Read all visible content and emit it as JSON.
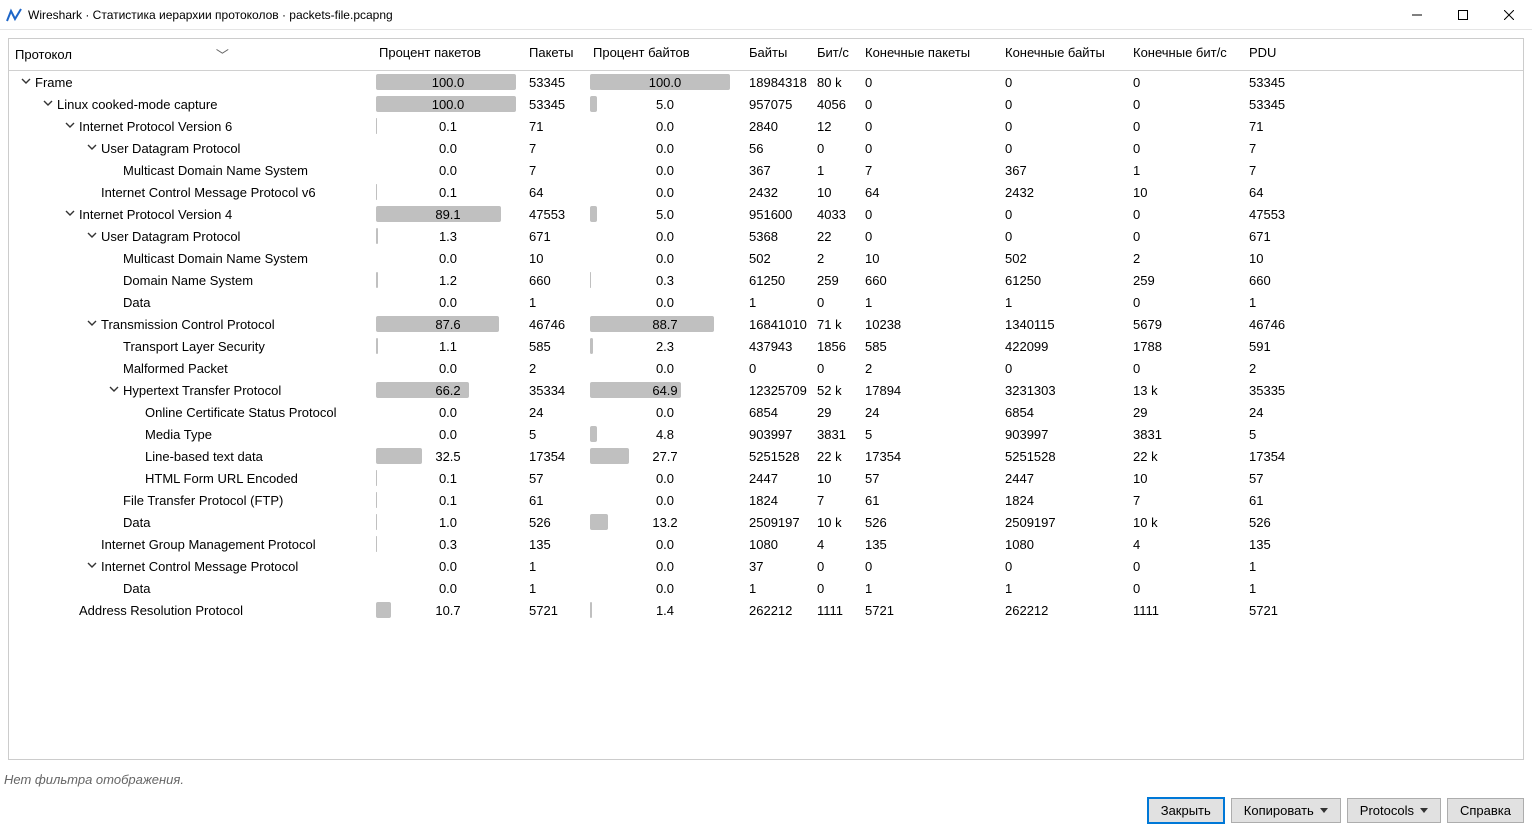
{
  "titlebar": {
    "title": "Wireshark · Статистика иерархии протоколов · packets-file.pcapng"
  },
  "columns": [
    "Протокол",
    "Процент пакетов",
    "Пакеты",
    "Процент байтов",
    "Байты",
    "Бит/с",
    "Конечные пакеты",
    "Конечные байты",
    "Конечные бит/с",
    "PDU"
  ],
  "rows": [
    {
      "depth": 0,
      "exp": "open",
      "name": "Frame",
      "ppct": "100.0",
      "pkts": "53345",
      "bpct": "100.0",
      "bytes": "18984318",
      "bits": "80 k",
      "ep": "0",
      "eb": "0",
      "ebits": "0",
      "pdu": "53345",
      "pbar": 100,
      "bbar": 100
    },
    {
      "depth": 1,
      "exp": "open",
      "name": "Linux cooked-mode capture",
      "ppct": "100.0",
      "pkts": "53345",
      "bpct": "5.0",
      "bytes": "957075",
      "bits": "4056",
      "ep": "0",
      "eb": "0",
      "ebits": "0",
      "pdu": "53345",
      "pbar": 100,
      "bbar": 5
    },
    {
      "depth": 2,
      "exp": "open",
      "name": "Internet Protocol Version 6",
      "ppct": "0.1",
      "pkts": "71",
      "bpct": "0.0",
      "bytes": "2840",
      "bits": "12",
      "ep": "0",
      "eb": "0",
      "ebits": "0",
      "pdu": "71",
      "pbar": 0.1,
      "bbar": 0
    },
    {
      "depth": 3,
      "exp": "open",
      "name": "User Datagram Protocol",
      "ppct": "0.0",
      "pkts": "7",
      "bpct": "0.0",
      "bytes": "56",
      "bits": "0",
      "ep": "0",
      "eb": "0",
      "ebits": "0",
      "pdu": "7",
      "pbar": 0,
      "bbar": 0
    },
    {
      "depth": 4,
      "exp": "none",
      "name": "Multicast Domain Name System",
      "ppct": "0.0",
      "pkts": "7",
      "bpct": "0.0",
      "bytes": "367",
      "bits": "1",
      "ep": "7",
      "eb": "367",
      "ebits": "1",
      "pdu": "7",
      "pbar": 0,
      "bbar": 0
    },
    {
      "depth": 3,
      "exp": "none",
      "name": "Internet Control Message Protocol v6",
      "ppct": "0.1",
      "pkts": "64",
      "bpct": "0.0",
      "bytes": "2432",
      "bits": "10",
      "ep": "64",
      "eb": "2432",
      "ebits": "10",
      "pdu": "64",
      "pbar": 0.1,
      "bbar": 0
    },
    {
      "depth": 2,
      "exp": "open",
      "name": "Internet Protocol Version 4",
      "ppct": "89.1",
      "pkts": "47553",
      "bpct": "5.0",
      "bytes": "951600",
      "bits": "4033",
      "ep": "0",
      "eb": "0",
      "ebits": "0",
      "pdu": "47553",
      "pbar": 89.1,
      "bbar": 5
    },
    {
      "depth": 3,
      "exp": "open",
      "name": "User Datagram Protocol",
      "ppct": "1.3",
      "pkts": "671",
      "bpct": "0.0",
      "bytes": "5368",
      "bits": "22",
      "ep": "0",
      "eb": "0",
      "ebits": "0",
      "pdu": "671",
      "pbar": 1.3,
      "bbar": 0
    },
    {
      "depth": 4,
      "exp": "none",
      "name": "Multicast Domain Name System",
      "ppct": "0.0",
      "pkts": "10",
      "bpct": "0.0",
      "bytes": "502",
      "bits": "2",
      "ep": "10",
      "eb": "502",
      "ebits": "2",
      "pdu": "10",
      "pbar": 0,
      "bbar": 0
    },
    {
      "depth": 4,
      "exp": "none",
      "name": "Domain Name System",
      "ppct": "1.2",
      "pkts": "660",
      "bpct": "0.3",
      "bytes": "61250",
      "bits": "259",
      "ep": "660",
      "eb": "61250",
      "ebits": "259",
      "pdu": "660",
      "pbar": 1.2,
      "bbar": 0.3
    },
    {
      "depth": 4,
      "exp": "none",
      "name": "Data",
      "ppct": "0.0",
      "pkts": "1",
      "bpct": "0.0",
      "bytes": "1",
      "bits": "0",
      "ep": "1",
      "eb": "1",
      "ebits": "0",
      "pdu": "1",
      "pbar": 0,
      "bbar": 0
    },
    {
      "depth": 3,
      "exp": "open",
      "name": "Transmission Control Protocol",
      "ppct": "87.6",
      "pkts": "46746",
      "bpct": "88.7",
      "bytes": "16841010",
      "bits": "71 k",
      "ep": "10238",
      "eb": "1340115",
      "ebits": "5679",
      "pdu": "46746",
      "pbar": 87.6,
      "bbar": 88.7
    },
    {
      "depth": 4,
      "exp": "none",
      "name": "Transport Layer Security",
      "ppct": "1.1",
      "pkts": "585",
      "bpct": "2.3",
      "bytes": "437943",
      "bits": "1856",
      "ep": "585",
      "eb": "422099",
      "ebits": "1788",
      "pdu": "591",
      "pbar": 1.1,
      "bbar": 2.3
    },
    {
      "depth": 4,
      "exp": "none",
      "name": "Malformed Packet",
      "ppct": "0.0",
      "pkts": "2",
      "bpct": "0.0",
      "bytes": "0",
      "bits": "0",
      "ep": "2",
      "eb": "0",
      "ebits": "0",
      "pdu": "2",
      "pbar": 0,
      "bbar": 0
    },
    {
      "depth": 4,
      "exp": "open",
      "name": "Hypertext Transfer Protocol",
      "ppct": "66.2",
      "pkts": "35334",
      "bpct": "64.9",
      "bytes": "12325709",
      "bits": "52 k",
      "ep": "17894",
      "eb": "3231303",
      "ebits": "13 k",
      "pdu": "35335",
      "pbar": 66.2,
      "bbar": 64.9
    },
    {
      "depth": 5,
      "exp": "none",
      "name": "Online Certificate Status Protocol",
      "ppct": "0.0",
      "pkts": "24",
      "bpct": "0.0",
      "bytes": "6854",
      "bits": "29",
      "ep": "24",
      "eb": "6854",
      "ebits": "29",
      "pdu": "24",
      "pbar": 0,
      "bbar": 0
    },
    {
      "depth": 5,
      "exp": "none",
      "name": "Media Type",
      "ppct": "0.0",
      "pkts": "5",
      "bpct": "4.8",
      "bytes": "903997",
      "bits": "3831",
      "ep": "5",
      "eb": "903997",
      "ebits": "3831",
      "pdu": "5",
      "pbar": 0,
      "bbar": 4.8
    },
    {
      "depth": 5,
      "exp": "none",
      "name": "Line-based text data",
      "ppct": "32.5",
      "pkts": "17354",
      "bpct": "27.7",
      "bytes": "5251528",
      "bits": "22 k",
      "ep": "17354",
      "eb": "5251528",
      "ebits": "22 k",
      "pdu": "17354",
      "pbar": 32.5,
      "bbar": 27.7
    },
    {
      "depth": 5,
      "exp": "none",
      "name": "HTML Form URL Encoded",
      "ppct": "0.1",
      "pkts": "57",
      "bpct": "0.0",
      "bytes": "2447",
      "bits": "10",
      "ep": "57",
      "eb": "2447",
      "ebits": "10",
      "pdu": "57",
      "pbar": 0.1,
      "bbar": 0
    },
    {
      "depth": 4,
      "exp": "none",
      "name": "File Transfer Protocol (FTP)",
      "ppct": "0.1",
      "pkts": "61",
      "bpct": "0.0",
      "bytes": "1824",
      "bits": "7",
      "ep": "61",
      "eb": "1824",
      "ebits": "7",
      "pdu": "61",
      "pbar": 0.1,
      "bbar": 0
    },
    {
      "depth": 4,
      "exp": "none",
      "name": "Data",
      "ppct": "1.0",
      "pkts": "526",
      "bpct": "13.2",
      "bytes": "2509197",
      "bits": "10 k",
      "ep": "526",
      "eb": "2509197",
      "ebits": "10 k",
      "pdu": "526",
      "pbar": 1,
      "bbar": 13.2
    },
    {
      "depth": 3,
      "exp": "none",
      "name": "Internet Group Management Protocol",
      "ppct": "0.3",
      "pkts": "135",
      "bpct": "0.0",
      "bytes": "1080",
      "bits": "4",
      "ep": "135",
      "eb": "1080",
      "ebits": "4",
      "pdu": "135",
      "pbar": 0.3,
      "bbar": 0
    },
    {
      "depth": 3,
      "exp": "open",
      "name": "Internet Control Message Protocol",
      "ppct": "0.0",
      "pkts": "1",
      "bpct": "0.0",
      "bytes": "37",
      "bits": "0",
      "ep": "0",
      "eb": "0",
      "ebits": "0",
      "pdu": "1",
      "pbar": 0,
      "bbar": 0
    },
    {
      "depth": 4,
      "exp": "none",
      "name": "Data",
      "ppct": "0.0",
      "pkts": "1",
      "bpct": "0.0",
      "bytes": "1",
      "bits": "0",
      "ep": "1",
      "eb": "1",
      "ebits": "0",
      "pdu": "1",
      "pbar": 0,
      "bbar": 0
    },
    {
      "depth": 2,
      "exp": "none",
      "name": "Address Resolution Protocol",
      "ppct": "10.7",
      "pkts": "5721",
      "bpct": "1.4",
      "bytes": "262212",
      "bits": "1111",
      "ep": "5721",
      "eb": "262212",
      "ebits": "1111",
      "pdu": "5721",
      "pbar": 10.7,
      "bbar": 1.4
    }
  ],
  "status": "Нет фильтра отображения.",
  "buttons": {
    "close": "Закрыть",
    "copy": "Копировать",
    "protocols": "Protocols",
    "help": "Справка"
  }
}
